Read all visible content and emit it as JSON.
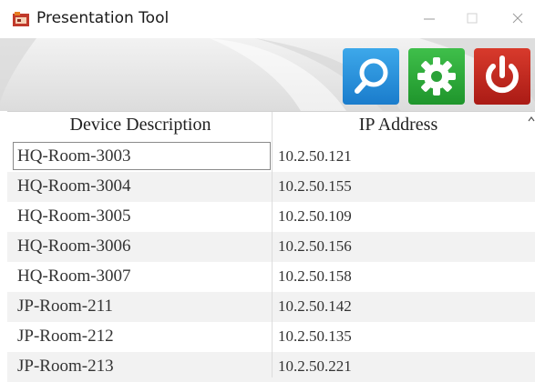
{
  "window": {
    "title": "Presentation Tool",
    "app_icon": "presentation-app-icon"
  },
  "title_controls": {
    "minimize": "minimize-icon",
    "maximize": "maximize-icon",
    "close": "close-icon"
  },
  "toolbar": {
    "buttons": [
      {
        "name": "search-button",
        "icon": "search-icon",
        "color": "#1a7ccc"
      },
      {
        "name": "settings-button",
        "icon": "gear-icon",
        "color": "#1f952c"
      },
      {
        "name": "power-button",
        "icon": "power-icon",
        "color": "#aa1b15"
      }
    ]
  },
  "table": {
    "columns": [
      "Device Description",
      "IP Address"
    ],
    "rows": [
      {
        "device": "HQ-Room-3003",
        "ip": "10.2.50.121"
      },
      {
        "device": "HQ-Room-3004",
        "ip": "10.2.50.155"
      },
      {
        "device": "HQ-Room-3005",
        "ip": "10.2.50.109"
      },
      {
        "device": "HQ-Room-3006",
        "ip": "10.2.50.156"
      },
      {
        "device": "HQ-Room-3007",
        "ip": "10.2.50.158"
      },
      {
        "device": "JP-Room-211",
        "ip": "10.2.50.142"
      },
      {
        "device": "JP-Room-212",
        "ip": "10.2.50.135"
      },
      {
        "device": "JP-Room-213",
        "ip": "10.2.50.221"
      }
    ],
    "selected_row": 0
  }
}
